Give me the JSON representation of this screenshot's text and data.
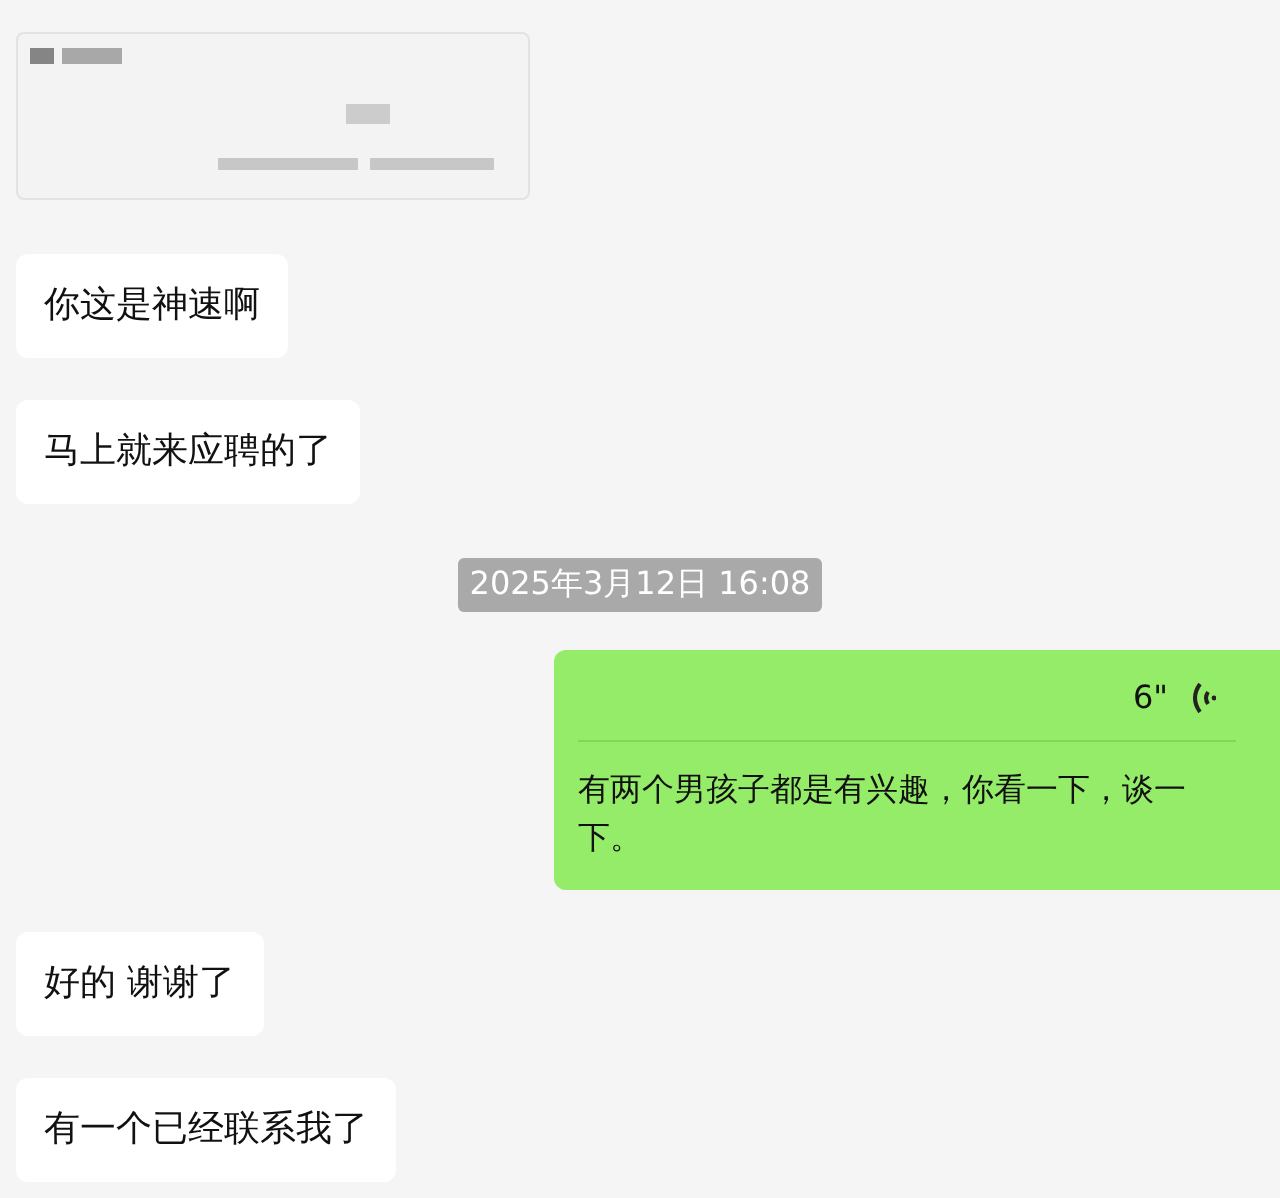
{
  "messages": [
    {
      "kind": "card"
    },
    {
      "kind": "text",
      "outgoing": false,
      "text": "你这是神速啊"
    },
    {
      "kind": "text",
      "outgoing": false,
      "text": "马上就来应聘的了"
    },
    {
      "kind": "time",
      "text": "2025年3月12日 16:08"
    },
    {
      "kind": "voice",
      "outgoing": true,
      "duration": "6\"",
      "transcript": "有两个男孩子都是有兴趣，你看一下，谈一下。"
    },
    {
      "kind": "text",
      "outgoing": false,
      "text": "好的 谢谢了"
    },
    {
      "kind": "text",
      "outgoing": false,
      "text": "有一个已经联系我了"
    }
  ]
}
